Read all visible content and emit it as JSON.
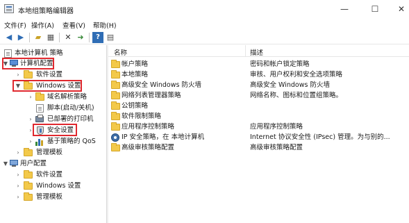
{
  "window": {
    "title": "本地组策略编辑器",
    "controls": {
      "minimize": "—",
      "maximize": "☐",
      "close": "✕"
    }
  },
  "menu": {
    "file": "文件(F)",
    "action": "操作(A)",
    "view": "查看(V)",
    "help": "帮助(H)"
  },
  "toolbar": {
    "icons": [
      "back-icon",
      "forward-icon",
      "up-folder-icon",
      "show-tree-icon",
      "delete-icon",
      "export-icon",
      "help-icon",
      "properties-icon"
    ]
  },
  "tree": {
    "root": "本地计算机 策略",
    "computer_config": "计算机配置",
    "software_settings": "软件设置",
    "windows_settings": "Windows 设置",
    "dns_policy": "域名解析策略",
    "scripts": "脚本(启动/关机)",
    "printers": "已部署的打印机",
    "security_settings": "安全设置",
    "qos": "基于策略的 QoS",
    "admin_templates": "管理模板",
    "user_config": "用户配置",
    "user_software_settings": "软件设置",
    "user_windows_settings": "Windows 设置",
    "user_admin_templates": "管理模板"
  },
  "list": {
    "columns": {
      "name": "名称",
      "description": "描述"
    },
    "rows": [
      {
        "name": "帐户策略",
        "desc": "密码和帐户锁定策略",
        "icon": "folder-icon"
      },
      {
        "name": "本地策略",
        "desc": "审核、用户权利和安全选项策略",
        "icon": "folder-icon"
      },
      {
        "name": "高级安全 Windows 防火墙",
        "desc": "高级安全 Windows 防火墙",
        "icon": "folder-icon"
      },
      {
        "name": "网络列表管理器策略",
        "desc": "网络名称、图标和位置组策略。",
        "icon": "folder-icon"
      },
      {
        "name": "公钥策略",
        "desc": "",
        "icon": "folder-icon"
      },
      {
        "name": "软件限制策略",
        "desc": "",
        "icon": "folder-icon"
      },
      {
        "name": "应用程序控制策略",
        "desc": "应用程序控制策略",
        "icon": "folder-icon"
      },
      {
        "name": "IP 安全策略，在 本地计算机",
        "desc": "Internet 协议安全性 (IPsec) 管理。为与别的...",
        "icon": "ipsec-icon"
      },
      {
        "name": "高级审核策略配置",
        "desc": "高级审核策略配置",
        "icon": "folder-icon"
      }
    ]
  },
  "colors": {
    "highlight_box": "#e0282e",
    "folder": "#f3c94a",
    "accent": "#4a78b5"
  }
}
